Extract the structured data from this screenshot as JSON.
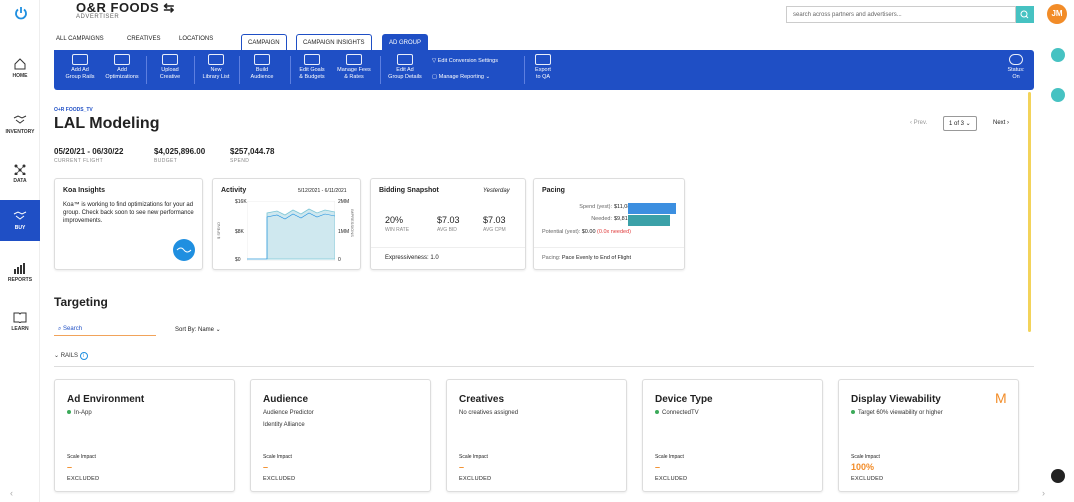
{
  "nav": {
    "home": "HOME",
    "inventory": "INVENTORY",
    "data": "DATA",
    "buy": "BUY",
    "reports": "REPORTS",
    "learn": "LEARN"
  },
  "header": {
    "brand": "O&R FOODS",
    "brand_sub": "ADVERTISER",
    "search_placeholder": "search across partners and advertisers...",
    "avatar": "JM"
  },
  "tabs": {
    "all_campaigns": "ALL CAMPAIGNS",
    "creatives": "CREATIVES",
    "locations": "LOCATIONS",
    "campaign": "CAMPAIGN",
    "campaign_insights": "CAMPAIGN INSIGHTS",
    "ad_group": "AD GROUP"
  },
  "toolbar": {
    "add_ad_group_rails": [
      "Add Ad",
      "Group Rails"
    ],
    "add_optimizations": [
      "Add",
      "Optimizations"
    ],
    "upload_creative": [
      "Upload",
      "Creative"
    ],
    "new_library_list": [
      "New",
      "Library List"
    ],
    "build_audience": [
      "Build",
      "Audience"
    ],
    "edit_goals": [
      "Edit Goals",
      "& Budgets"
    ],
    "manage_fees": [
      "Manage Fees",
      "& Rates"
    ],
    "edit_ad_group_details": [
      "Edit Ad",
      "Group Details"
    ],
    "edit_conversion_settings": "Edit Conversion Settings",
    "manage_reporting": "Manage Reporting",
    "export_to_qa": [
      "Export",
      "to QA"
    ],
    "status": [
      "Status:",
      "On"
    ]
  },
  "page": {
    "crumb": "O+R FOODS_TV",
    "title": "LAL Modeling",
    "prev": "Prev.",
    "page": "1 of 3",
    "next": "Next"
  },
  "stats": [
    {
      "value": "05/20/21 - 06/30/22",
      "label": "CURRENT FLIGHT"
    },
    {
      "value": "$4,025,896.00",
      "label": "BUDGET"
    },
    {
      "value": "$257,044.78",
      "label": "SPEND"
    }
  ],
  "koa": {
    "title": "Koa Insights",
    "body": "Koa™ is working to find optimizations for your ad group. Check back soon to see new performance improvements."
  },
  "activity": {
    "title": "Activity",
    "range": "5/12/2021 - 6/11/2021",
    "y_left": [
      "$16K",
      "$8K",
      "$0"
    ],
    "y_right": [
      "2MM",
      "1MM",
      "0"
    ],
    "left_axis": "$ SPEND",
    "right_axis": "IMPRESSIONS"
  },
  "bidding": {
    "title": "Bidding Snapshot",
    "period": "Yesterday",
    "metrics": [
      {
        "v": "20%",
        "l": "WIN RATE"
      },
      {
        "v": "$7.03",
        "l": "AVG BID"
      },
      {
        "v": "$7.03",
        "l": "AVG CPM"
      }
    ],
    "footer_label": "Expressiveness:",
    "footer_value": "1.0"
  },
  "pacing": {
    "title": "Pacing",
    "spend_label": "Spend (yest):",
    "spend_value": "$11,080.36",
    "needed_label": "Needed:",
    "needed_value": "$9,816.15",
    "potential_label": "Potential (yest):",
    "potential_value": "$0.00",
    "potential_note": "(0.0x needed)",
    "footer_label": "Pacing:",
    "footer_value": "Pace Evenly to End of Flight"
  },
  "targeting": {
    "title": "Targeting",
    "search_placeholder": "Search",
    "sort": "Sort By: Name",
    "rails": "RAILS"
  },
  "rail_cards": [
    {
      "title": "Ad Environment",
      "lines": [
        "In-App"
      ],
      "dotted": true,
      "scale_label": "Scale Impact",
      "scale": "–",
      "excluded": "EXCLUDED"
    },
    {
      "title": "Audience",
      "lines": [
        "Audience Predictor",
        "Identity Alliance"
      ],
      "dotted": false,
      "scale_label": "Scale Impact",
      "scale": "–",
      "excluded": "EXCLUDED"
    },
    {
      "title": "Creatives",
      "lines": [
        "No creatives assigned"
      ],
      "dotted": false,
      "scale_label": "Scale Impact",
      "scale": "–",
      "excluded": "EXCLUDED"
    },
    {
      "title": "Device Type",
      "lines": [
        "ConnectedTV"
      ],
      "dotted": true,
      "scale_label": "Scale Impact",
      "scale": "–",
      "excluded": "EXCLUDED"
    },
    {
      "title": "Display Viewability",
      "lines": [
        "Target 60% viewability or higher"
      ],
      "dotted": true,
      "scale_label": "Scale Impact",
      "scale": "100%",
      "excluded": "EXCLUDED",
      "badge": "M"
    }
  ]
}
